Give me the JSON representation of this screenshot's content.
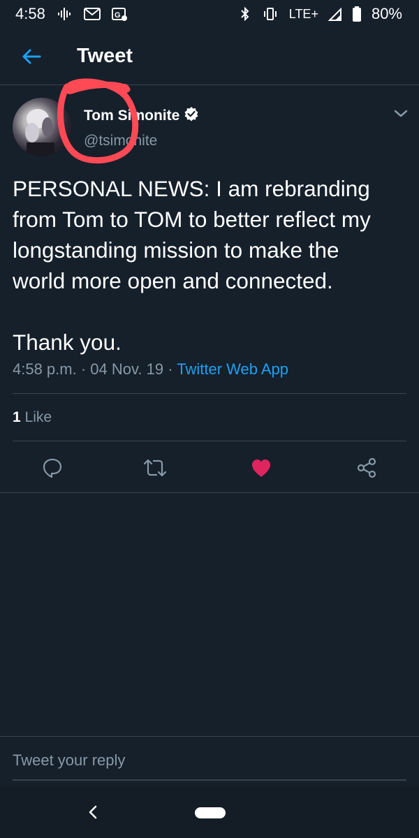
{
  "status_bar": {
    "time": "4:58",
    "network": "LTE+",
    "battery": "80%",
    "icons": [
      "podcast-icon",
      "gmail-icon",
      "google-news-icon",
      "bluetooth-icon",
      "vibrate-icon",
      "signal-icon",
      "battery-icon"
    ]
  },
  "header": {
    "title": "Tweet",
    "back_icon": "arrow-left-icon"
  },
  "tweet": {
    "author_name": "Tom Simonite",
    "verified": true,
    "handle": "@tsimonite",
    "text": "PERSONAL NEWS: I am rebranding\nfrom Tom to TOM to better reflect my\nlongstanding mission to make the\nworld more open and connected.\n\nThank you.",
    "time": "4:58 p.m.",
    "date": "04 Nov. 19",
    "source": "Twitter Web App",
    "like_count": "1",
    "like_label": "Like"
  },
  "actions": [
    "reply-icon",
    "retweet-icon",
    "like-icon",
    "share-icon"
  ],
  "reply": {
    "placeholder": "Tweet your reply"
  },
  "colors": {
    "background": "#15202b",
    "accent": "#1da1f2",
    "secondary_text": "#8899a6",
    "like": "#e0245e",
    "annotation": "#ff4a55"
  }
}
